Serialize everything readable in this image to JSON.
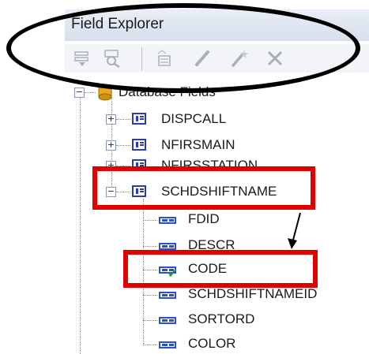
{
  "panel": {
    "title": "Field Explorer"
  },
  "toolbar": {
    "buttons": [
      {
        "icon": "insert-field-icon"
      },
      {
        "icon": "browse-data-icon"
      },
      {
        "icon": "new-formula-icon"
      },
      {
        "icon": "edit-icon"
      },
      {
        "icon": "rename-icon"
      },
      {
        "icon": "delete-icon"
      }
    ]
  },
  "tree": {
    "root": {
      "label": "Database Fields",
      "icon": "database-icon",
      "expanded": true
    },
    "tables": [
      {
        "label": "DISPCALL",
        "expanded": false
      },
      {
        "label": "NFIRSMAIN",
        "expanded": false
      },
      {
        "label": "NFIRSSTATION",
        "expanded": false
      },
      {
        "label": "SCHDSHIFTNAME",
        "expanded": true
      }
    ],
    "fields": [
      {
        "label": "FDID",
        "used": false
      },
      {
        "label": "DESCR",
        "used": false
      },
      {
        "label": "CODE",
        "used": true
      },
      {
        "label": "SCHDSHIFTNAMEID",
        "used": false
      },
      {
        "label": "SORTORD",
        "used": false
      },
      {
        "label": "COLOR",
        "used": false
      }
    ]
  },
  "annotations": {
    "ellipse_color": "#000000",
    "box_color": "#e00000",
    "arrow_color": "#000000"
  }
}
